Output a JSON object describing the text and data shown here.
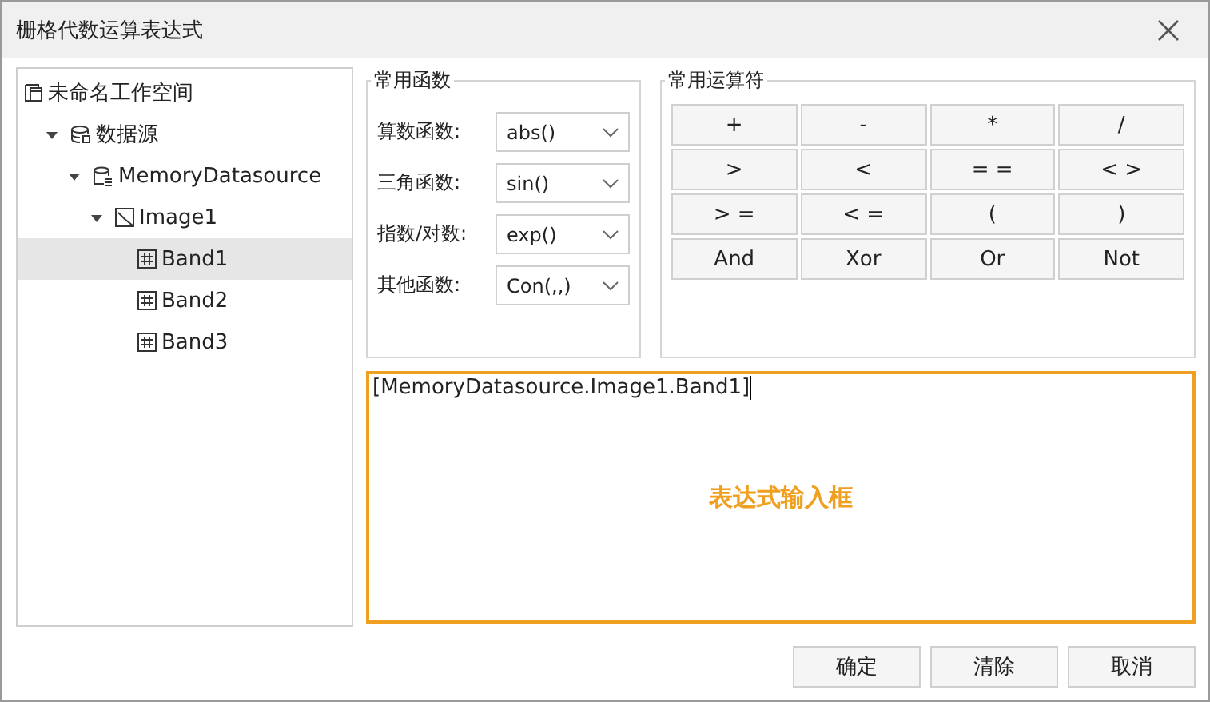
{
  "window": {
    "title": "栅格代数运算表达式"
  },
  "tree": [
    {
      "label": "未命名工作空间",
      "kind": "workspace",
      "selected": false,
      "children": [
        {
          "label": "数据源",
          "kind": "datasources",
          "selected": false,
          "expanded": true,
          "children": [
            {
              "label": "MemoryDatasource",
              "kind": "datasource",
              "selected": false,
              "expanded": true,
              "children": [
                {
                  "label": "Image1",
                  "kind": "image",
                  "selected": false,
                  "expanded": true,
                  "children": [
                    {
                      "label": "Band1",
                      "kind": "band",
                      "selected": true
                    },
                    {
                      "label": "Band2",
                      "kind": "band",
                      "selected": false
                    },
                    {
                      "label": "Band3",
                      "kind": "band",
                      "selected": false
                    }
                  ]
                }
              ]
            }
          ]
        }
      ]
    }
  ],
  "functions": {
    "title": "常用函数",
    "rows": [
      {
        "label": "算数函数:",
        "value": "abs()"
      },
      {
        "label": "三角函数:",
        "value": "sin()"
      },
      {
        "label": "指数/对数:",
        "value": "exp()"
      },
      {
        "label": "其他函数:",
        "value": "Con(,,)"
      }
    ]
  },
  "operators": {
    "title": "常用运算符",
    "items": [
      "+",
      "-",
      "*",
      "/",
      ">",
      "<",
      "= =",
      "< >",
      "> =",
      "< =",
      "(",
      ")",
      "And",
      "Xor",
      "Or",
      "Not"
    ]
  },
  "expression": {
    "value": "[MemoryDatasource.Image1.Band1]",
    "annotation": "表达式输入框"
  },
  "buttons": [
    "确定",
    "清除",
    "取消"
  ]
}
